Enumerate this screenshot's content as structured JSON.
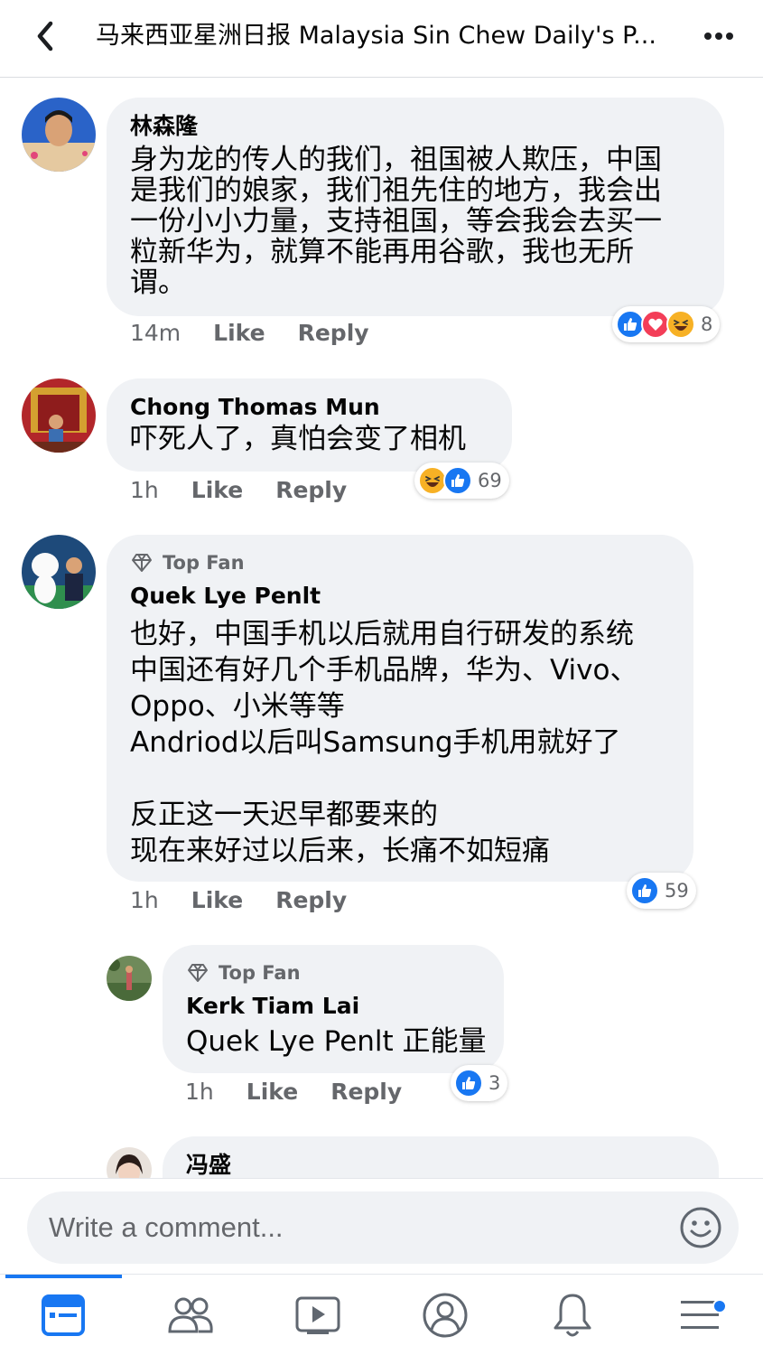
{
  "header": {
    "title": "马来西亚星洲日报 Malaysia Sin Chew Daily's P...",
    "back_icon": "chevron-left-icon",
    "more_icon": "more-dots-icon"
  },
  "comments": [
    {
      "author": "林森隆",
      "text_lines": [
        "身为龙的传人的我们，祖国被人欺压，中国",
        "是我们的娘家，我们祖先住的地方，我会出",
        "一份小小力量，支持祖国，等会我会去买一",
        "粒新华为，就算不能再用谷歌，我也无所",
        "谓。"
      ],
      "time": "14m",
      "like_label": "Like",
      "reply_label": "Reply",
      "reactions": [
        "like",
        "love",
        "haha"
      ],
      "reaction_count": "8"
    },
    {
      "author": "Chong Thomas Mun",
      "text_lines": [
        "吓死人了，真怕会变了相机"
      ],
      "time": "1h",
      "like_label": "Like",
      "reply_label": "Reply",
      "reactions": [
        "haha",
        "like"
      ],
      "reaction_count": "69"
    },
    {
      "badge": "Top Fan",
      "author": "Quek Lye Penlt",
      "text_lines": [
        "也好，中国手机以后就用自行研发的系统",
        "中国还有好几个手机品牌，华为、Vivo、",
        "Oppo、小米等等",
        "Andriod以后叫Samsung手机用就好了",
        "",
        "反正这一天迟早都要来的",
        "现在来好过以后来，长痛不如短痛"
      ],
      "time": "1h",
      "like_label": "Like",
      "reply_label": "Reply",
      "reactions": [
        "like"
      ],
      "reaction_count": "59"
    },
    {
      "badge": "Top Fan",
      "author": "Kerk Tiam Lai",
      "text_lines": [
        "Quek Lye Penlt 正能量"
      ],
      "time": "1h",
      "like_label": "Like",
      "reply_label": "Reply",
      "reactions": [
        "like"
      ],
      "reaction_count": "3"
    },
    {
      "author": "冯盛"
    }
  ],
  "composer": {
    "placeholder": "Write a comment...",
    "emoji_icon": "smiley-icon"
  },
  "tabs": [
    "news-feed-icon",
    "friends-icon",
    "watch-icon",
    "profile-icon",
    "notifications-icon",
    "menu-icon"
  ],
  "colors": {
    "accent": "#1877f2",
    "bubble": "#f0f2f5",
    "secondary_text": "#65676b",
    "love": "#f33e58",
    "haha": "#f7b125"
  }
}
